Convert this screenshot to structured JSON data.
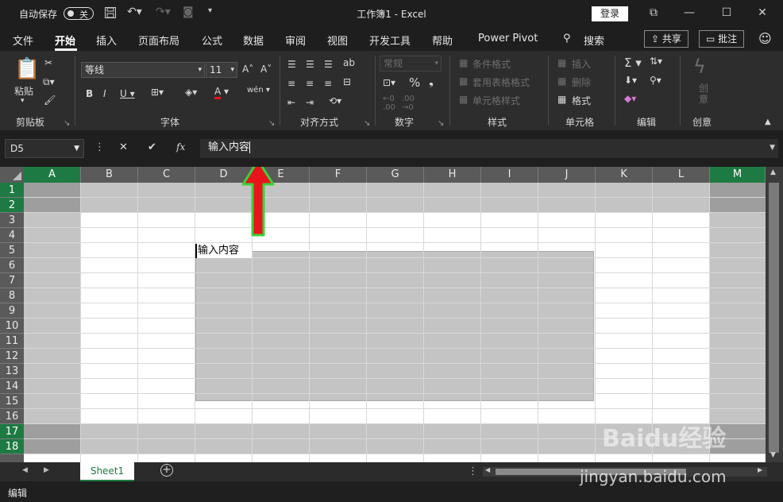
{
  "title_bar": {
    "autosave_label": "自动保存",
    "autosave_state": "关",
    "document_title": "工作簿1  -  Excel",
    "login_label": "登录"
  },
  "tabs": [
    "文件",
    "开始",
    "插入",
    "页面布局",
    "公式",
    "数据",
    "审阅",
    "视图",
    "开发工具",
    "帮助",
    "Power Pivot"
  ],
  "active_tab": "开始",
  "search_label": "搜索",
  "share_label": "共享",
  "comment_label": "批注",
  "ribbon": {
    "clipboard": {
      "paste_label": "粘贴",
      "group_label": "剪贴板"
    },
    "font": {
      "font_name": "等线",
      "font_size": "11",
      "group_label": "字体"
    },
    "alignment": {
      "group_label": "对齐方式"
    },
    "number": {
      "format": "常规",
      "group_label": "数字"
    },
    "styles": {
      "conditional": "条件格式",
      "table": "套用表格格式",
      "cell_styles": "单元格样式",
      "group_label": "样式"
    },
    "cells": {
      "insert": "插入",
      "delete": "删除",
      "format": "格式",
      "group_label": "单元格"
    },
    "editing": {
      "group_label": "编辑"
    },
    "creative": {
      "create": "创意",
      "group_label": "创意"
    }
  },
  "formula_bar": {
    "name_box": "D5",
    "content": "输入内容"
  },
  "grid": {
    "columns": [
      "A",
      "B",
      "C",
      "D",
      "E",
      "F",
      "G",
      "H",
      "I",
      "J",
      "K",
      "L",
      "M"
    ],
    "rows": [
      "1",
      "2",
      "3",
      "4",
      "5",
      "6",
      "7",
      "8",
      "9",
      "10",
      "11",
      "12",
      "13",
      "14",
      "15",
      "16",
      "17",
      "18"
    ],
    "active_cell": "D5",
    "active_cell_value": "输入内容"
  },
  "sheets": [
    "Sheet1"
  ],
  "status": "编辑",
  "colors": {
    "selected_header": "#1e7a43",
    "selection_fill": "#c4c4c4",
    "arrow_fill": "#e8141b",
    "arrow_outline": "#3ad13a"
  },
  "watermark": {
    "main": "Baidu经验",
    "url": "jingyan.baidu.com"
  }
}
